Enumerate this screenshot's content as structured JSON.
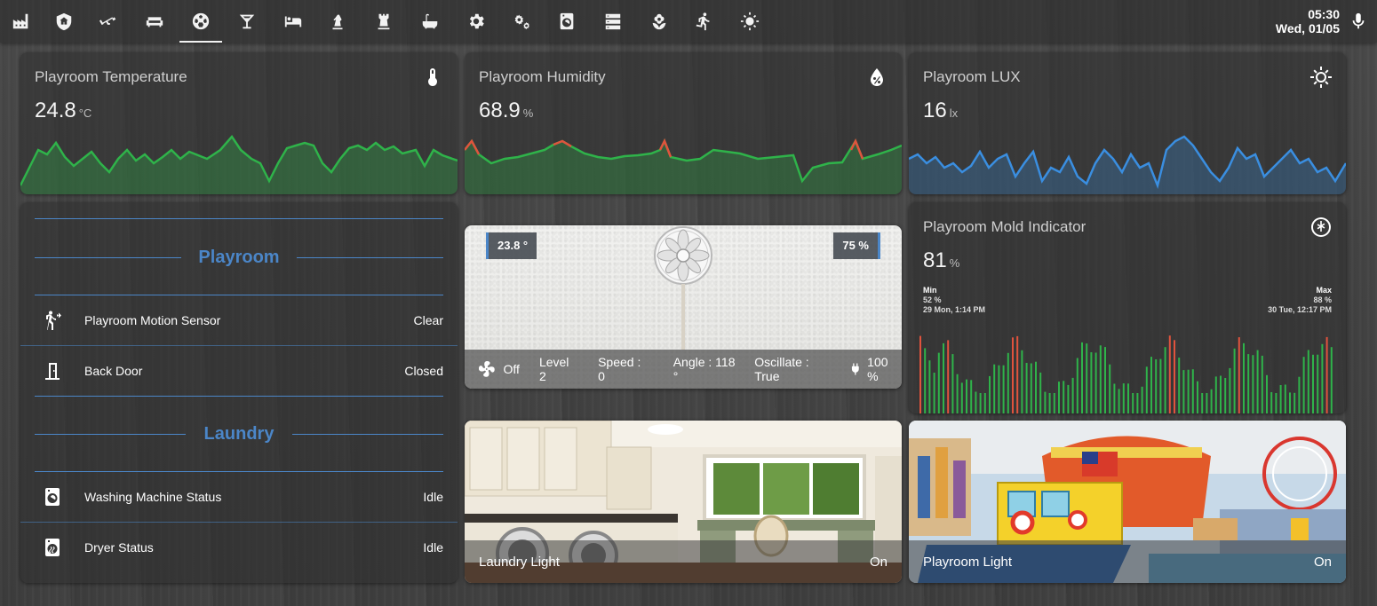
{
  "nav": {
    "tabs": [
      {
        "icon": "factory-icon"
      },
      {
        "icon": "home-shield-icon"
      },
      {
        "icon": "cctv-icon"
      },
      {
        "icon": "sofa-icon"
      },
      {
        "icon": "soccer-ball-icon",
        "active": true
      },
      {
        "icon": "cocktail-glass-icon"
      },
      {
        "icon": "bed-icon"
      },
      {
        "icon": "chess-knight-icon"
      },
      {
        "icon": "chess-rook-icon"
      },
      {
        "icon": "bathtub-icon"
      },
      {
        "icon": "gear-icon"
      },
      {
        "icon": "gears-icon"
      },
      {
        "icon": "washing-machine-icon"
      },
      {
        "icon": "server-icon"
      },
      {
        "icon": "flower-icon"
      },
      {
        "icon": "running-man-icon"
      },
      {
        "icon": "sun-icon"
      }
    ],
    "time": "05:30",
    "date": "Wed, 01/05"
  },
  "sensors": {
    "temperature": {
      "title": "Playroom Temperature",
      "value": "24.8",
      "unit": "°C",
      "icon": "thermometer-icon"
    },
    "humidity": {
      "title": "Playroom Humidity",
      "value": "68.9",
      "unit": "%",
      "icon": "water-percent-icon"
    },
    "lux": {
      "title": "Playroom LUX",
      "value": "16",
      "unit": "lx",
      "icon": "brightness-icon"
    },
    "mold": {
      "title": "Playroom Mold Indicator",
      "value": "81",
      "unit": "%",
      "icon": "snowflake-icon",
      "min_label": "Min",
      "min_value": "52 %",
      "min_time": "29 Mon, 1:14 PM",
      "max_label": "Max",
      "max_value": "88 %",
      "max_time": "30 Tue, 12:17 PM"
    }
  },
  "colors": {
    "accent": "#4b86c8",
    "line_green": "#2fb34a",
    "line_red": "#e0533d",
    "line_blue": "#3a8ee0"
  },
  "entities": {
    "sections": [
      {
        "title": "Playroom",
        "rows": [
          {
            "icon": "motion-sensor-icon",
            "name": "Playroom Motion Sensor",
            "state": "Clear"
          },
          {
            "icon": "door-icon",
            "name": "Back Door",
            "state": "Closed"
          }
        ]
      },
      {
        "title": "Laundry",
        "rows": [
          {
            "icon": "washing-machine-icon",
            "name": "Washing Machine Status",
            "state": "Idle"
          },
          {
            "icon": "tumble-dryer-icon",
            "name": "Dryer Status",
            "state": "Idle"
          }
        ]
      }
    ]
  },
  "fan": {
    "temperature": "23.8 °",
    "humidity": "75 %",
    "power": "Off",
    "level": "Level 2",
    "speed": "Speed : 0",
    "angle": "Angle : 118 °",
    "oscillate": "Oscillate : True",
    "battery": "100 %"
  },
  "lights": {
    "laundry": {
      "name": "Laundry Light",
      "state": "On"
    },
    "playroom": {
      "name": "Playroom Light",
      "state": "On"
    }
  }
}
